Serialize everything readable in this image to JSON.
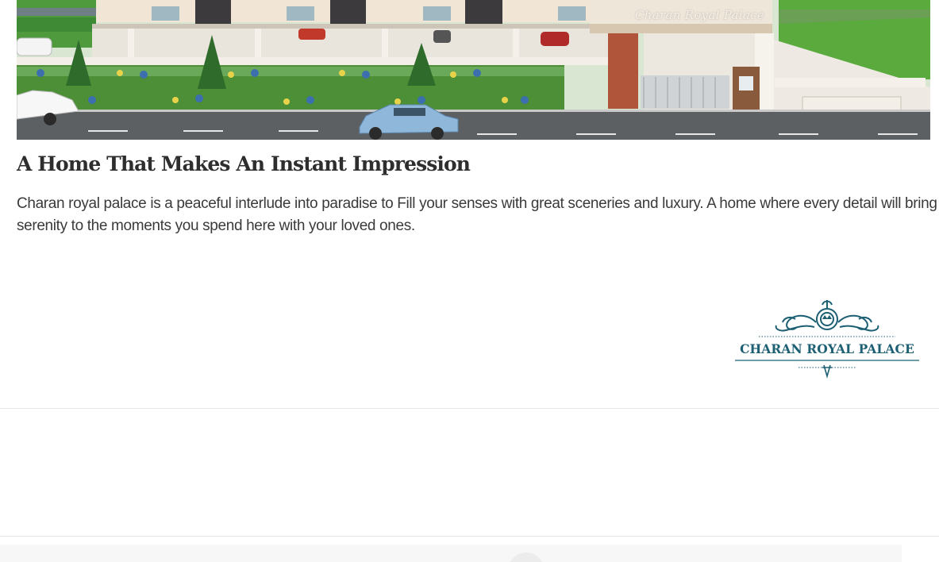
{
  "hero": {
    "caption": "Charan Royal Palace"
  },
  "content": {
    "headline": "A Home That Makes An Instant Impression",
    "description": "Charan royal palace is a peaceful interlude into paradise to Fill your senses with great sceneries and luxury. A home where every detail will bring serenity to the moments you spend here with your loved ones."
  },
  "logo": {
    "text": "CHARAN ROYAL PALACE",
    "color": "#1d5f73"
  }
}
